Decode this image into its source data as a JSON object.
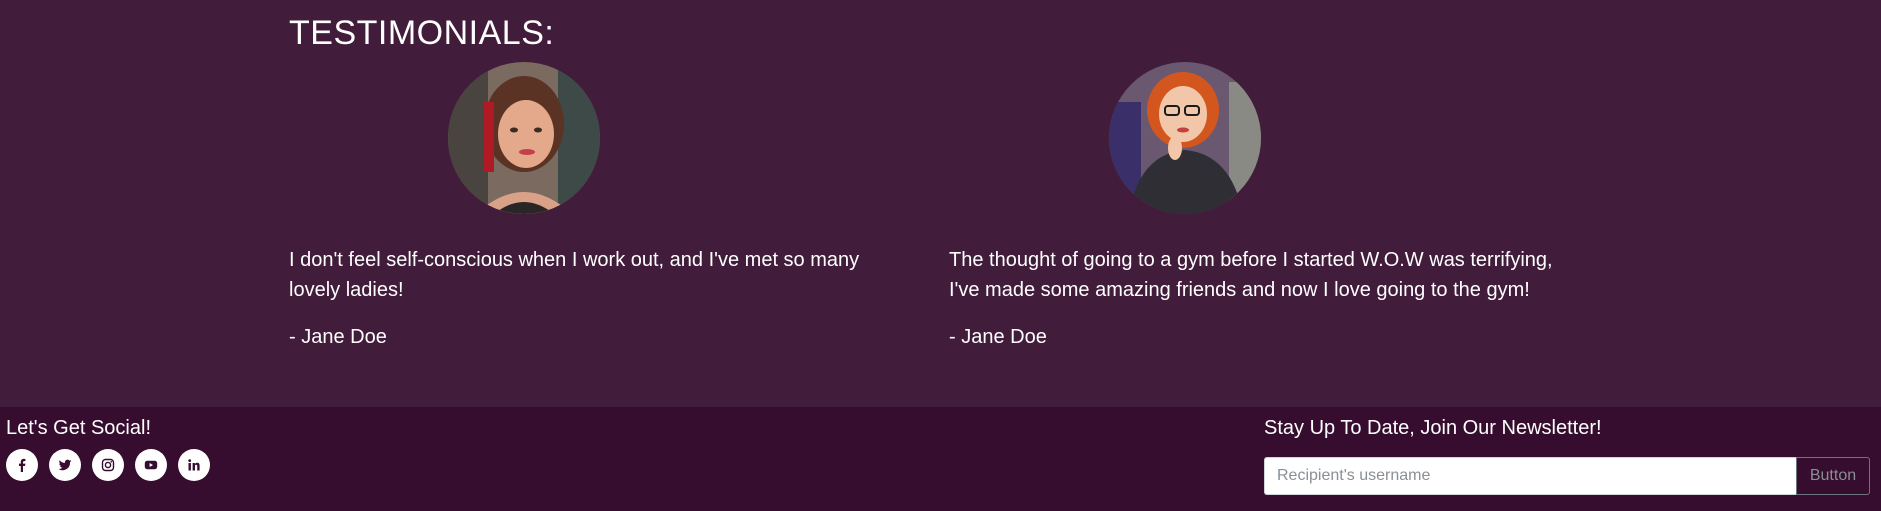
{
  "testimonials": {
    "title": "TESTIMONIALS:",
    "items": [
      {
        "quote": "I don't feel self-conscious when I work out, and I've met so many lovely ladies!",
        "author": "- Jane Doe"
      },
      {
        "quote": "The thought of going to a gym before I started W.O.W was terrifying, I've made some amazing friends and now I love going to the gym!",
        "author": "- Jane Doe"
      }
    ]
  },
  "footer": {
    "social_heading": "Let's Get Social!",
    "social_icons": [
      "facebook-icon",
      "twitter-icon",
      "instagram-icon",
      "youtube-icon",
      "linkedin-icon"
    ],
    "newsletter_heading": "Stay Up To Date, Join Our Newsletter!",
    "newsletter_placeholder": "Recipient's username",
    "newsletter_button": "Button"
  },
  "colors": {
    "section_bg": "#421c3b",
    "footer_bg": "#360d2e",
    "text": "#ffffff"
  }
}
